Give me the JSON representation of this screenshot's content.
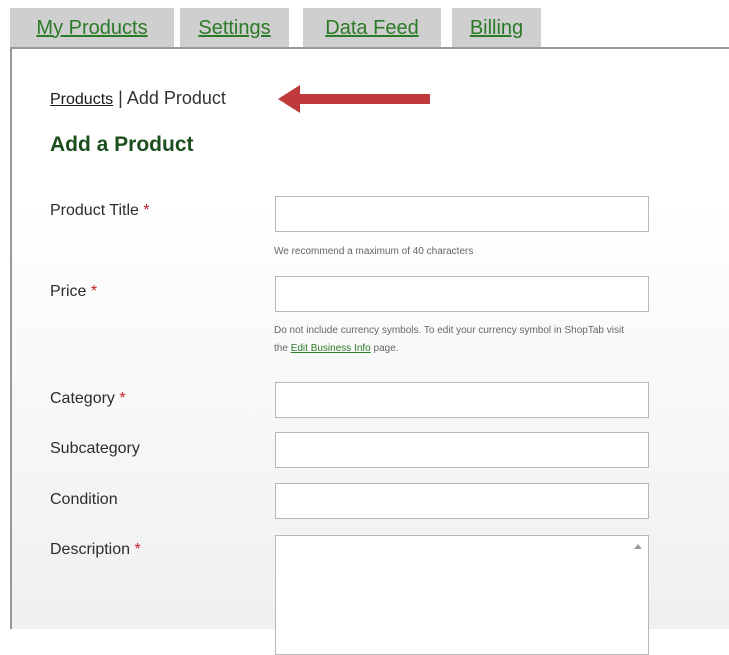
{
  "tabs": [
    {
      "label": "My Products"
    },
    {
      "label": "Settings"
    },
    {
      "label": "Data Feed"
    },
    {
      "label": "Billing"
    }
  ],
  "breadcrumb": {
    "link": "Products",
    "separator": " | ",
    "current": "Add Product"
  },
  "page_title": "Add a Product",
  "required_marker": "*",
  "form": {
    "product_title": {
      "label": "Product Title",
      "value": "",
      "hint": "We recommend a maximum of 40 characters"
    },
    "price": {
      "label": "Price",
      "value": "",
      "hint_line1": "Do not include currency symbols. To edit your currency symbol in ShopTab visit",
      "hint_prefix": "the ",
      "hint_link": "Edit Business Info",
      "hint_suffix": " page."
    },
    "category": {
      "label": "Category",
      "value": ""
    },
    "subcategory": {
      "label": "Subcategory",
      "value": ""
    },
    "condition": {
      "label": "Condition",
      "value": ""
    },
    "description": {
      "label": "Description",
      "value": ""
    }
  },
  "colors": {
    "tab_link": "#2b7a27",
    "title": "#1d4f1e",
    "required": "#c0202a",
    "arrow": "#c0393b"
  },
  "icons": {
    "arrow": "left-arrow-icon",
    "scroll": "scroll-up-icon"
  }
}
